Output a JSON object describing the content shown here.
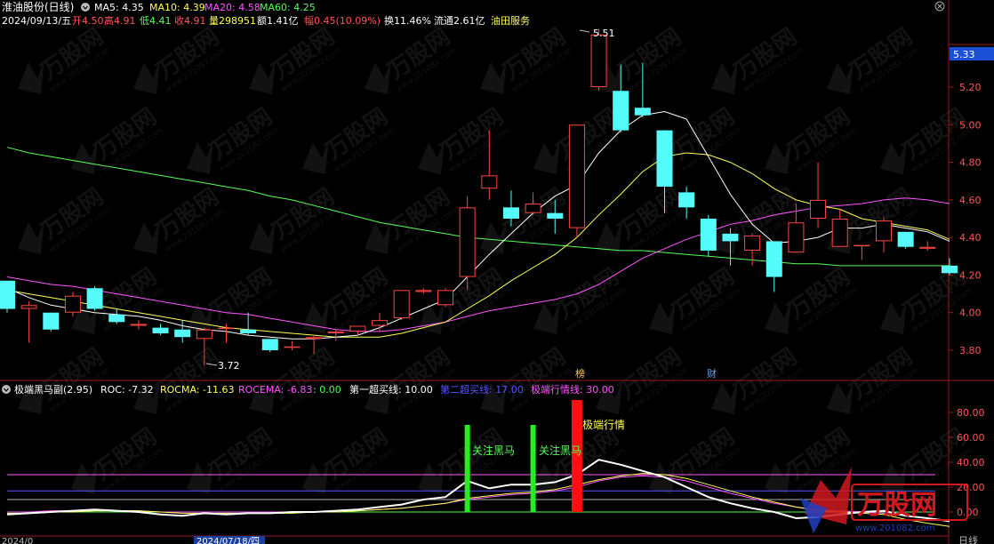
{
  "colors": {
    "up": "#ff4444",
    "down": "#54fcfc",
    "ma5": "#ffffff",
    "ma10": "#ffff55",
    "ma20": "#ff55ff",
    "ma60": "#55ff55",
    "axis_red": "#9a1a1a",
    "text_yellow": "#ffff55",
    "text_red": "#ff5555",
    "text_green": "#55ff55",
    "text_magenta": "#ff55ff",
    "text_blue": "#5555ff",
    "watermark_red": "#d0181f",
    "watermark_blue": "#1e3fbf"
  },
  "header": {
    "title": "淮油股份(日线)",
    "ma5": "MA5: 4.35",
    "ma10": "MA10: 4.39",
    "ma20": "MA20: 4.58",
    "ma60": "MA60: 4.25",
    "line2": {
      "date": "2024/09/13/五",
      "open": "开4.50",
      "high": "高4.91",
      "low": "低4.41",
      "close": "收4.91",
      "volume": "量298951",
      "amount": "额1.41亿",
      "change": "幅0.45(10.09%)",
      "turnover": "换11.46%",
      "float": "流通2.61亿",
      "sector": "油田服务"
    }
  },
  "price_axis": {
    "labels": [
      "5.20",
      "5.00",
      "4.80",
      "4.60",
      "4.40",
      "4.20",
      "4.00",
      "3.80"
    ],
    "current_label": "5.33"
  },
  "annotations": {
    "high_label": "5.51",
    "low_label": "3.72",
    "bang_tag": "榜",
    "cai_tag": "财"
  },
  "indicator": {
    "name": "极端黑马副(2.95)",
    "roc": "ROC: -7.32",
    "rocma": "ROCMA: -11.63",
    "rocema": "ROCEMA: -6.83",
    "zero": ": 0.00",
    "buy1": "第一超买线: 10.00",
    "buy2": "第二超买线: 17.00",
    "extreme": "极端行情线: 30.00",
    "axis_labels": [
      "80.00",
      "60.00",
      "40.00",
      "20.00",
      "0.00"
    ],
    "signal1": "关注黑马",
    "signal2": "关注黑马",
    "signal3": "极端行情"
  },
  "bottom_axis": {
    "date_label": "2024/07/18/四",
    "left_label": "2024/0",
    "right_label": "日线"
  },
  "watermark": {
    "brand": "万股网",
    "site": "www.201082.com"
  },
  "chart_data": {
    "type": "candlestick",
    "y_range": [
      3.7,
      5.55
    ],
    "candles": [
      {
        "o": 4.17,
        "h": 4.17,
        "l": 4.0,
        "c": 4.02
      },
      {
        "o": 4.02,
        "h": 4.06,
        "l": 3.84,
        "c": 4.04
      },
      {
        "o": 4.0,
        "h": 4.0,
        "l": 3.9,
        "c": 3.91
      },
      {
        "o": 4.0,
        "h": 4.11,
        "l": 3.98,
        "c": 4.09
      },
      {
        "o": 4.13,
        "h": 4.14,
        "l": 4.01,
        "c": 4.02
      },
      {
        "o": 3.99,
        "h": 4.02,
        "l": 3.94,
        "c": 3.95
      },
      {
        "o": 3.93,
        "h": 3.96,
        "l": 3.91,
        "c": 3.94
      },
      {
        "o": 3.92,
        "h": 3.94,
        "l": 3.88,
        "c": 3.89
      },
      {
        "o": 3.91,
        "h": 3.96,
        "l": 3.84,
        "c": 3.87
      },
      {
        "o": 3.86,
        "h": 3.92,
        "l": 3.72,
        "c": 3.91
      },
      {
        "o": 3.92,
        "h": 3.94,
        "l": 3.84,
        "c": 3.92
      },
      {
        "o": 3.91,
        "h": 4.0,
        "l": 3.88,
        "c": 3.89
      },
      {
        "o": 3.86,
        "h": 3.86,
        "l": 3.79,
        "c": 3.8
      },
      {
        "o": 3.82,
        "h": 3.85,
        "l": 3.8,
        "c": 3.82
      },
      {
        "o": 3.86,
        "h": 3.88,
        "l": 3.78,
        "c": 3.87
      },
      {
        "o": 3.89,
        "h": 3.91,
        "l": 3.85,
        "c": 3.9
      },
      {
        "o": 3.9,
        "h": 3.92,
        "l": 3.88,
        "c": 3.93
      },
      {
        "o": 3.93,
        "h": 4.0,
        "l": 3.9,
        "c": 3.96
      },
      {
        "o": 3.97,
        "h": 4.12,
        "l": 3.96,
        "c": 4.12
      },
      {
        "o": 4.11,
        "h": 4.13,
        "l": 4.1,
        "c": 4.12
      },
      {
        "o": 4.04,
        "h": 4.13,
        "l": 4.03,
        "c": 4.12
      },
      {
        "o": 4.19,
        "h": 4.62,
        "l": 4.12,
        "c": 4.56
      },
      {
        "o": 4.66,
        "h": 4.97,
        "l": 4.6,
        "c": 4.73
      },
      {
        "o": 4.56,
        "h": 4.65,
        "l": 4.46,
        "c": 4.5
      },
      {
        "o": 4.53,
        "h": 4.64,
        "l": 4.52,
        "c": 4.58
      },
      {
        "o": 4.53,
        "h": 4.6,
        "l": 4.42,
        "c": 4.5
      },
      {
        "o": 4.45,
        "h": 5.0,
        "l": 4.4,
        "c": 5.0
      },
      {
        "o": 5.2,
        "h": 5.51,
        "l": 5.18,
        "c": 5.48
      },
      {
        "o": 5.18,
        "h": 5.32,
        "l": 4.96,
        "c": 4.97
      },
      {
        "o": 5.09,
        "h": 5.33,
        "l": 5.04,
        "c": 5.05
      },
      {
        "o": 4.97,
        "h": 4.97,
        "l": 4.53,
        "c": 4.67
      },
      {
        "o": 4.64,
        "h": 4.67,
        "l": 4.5,
        "c": 4.56
      },
      {
        "o": 4.5,
        "h": 4.52,
        "l": 4.3,
        "c": 4.33
      },
      {
        "o": 4.42,
        "h": 4.45,
        "l": 4.25,
        "c": 4.38
      },
      {
        "o": 4.33,
        "h": 4.42,
        "l": 4.25,
        "c": 4.41
      },
      {
        "o": 4.38,
        "h": 4.38,
        "l": 4.11,
        "c": 4.19
      },
      {
        "o": 4.32,
        "h": 4.58,
        "l": 4.32,
        "c": 4.48
      },
      {
        "o": 4.5,
        "h": 4.8,
        "l": 4.45,
        "c": 4.6
      },
      {
        "o": 4.35,
        "h": 4.55,
        "l": 4.35,
        "c": 4.5
      },
      {
        "o": 4.36,
        "h": 4.36,
        "l": 4.28,
        "c": 4.36
      },
      {
        "o": 4.38,
        "h": 4.51,
        "l": 4.32,
        "c": 4.49
      },
      {
        "o": 4.43,
        "h": 4.43,
        "l": 4.34,
        "c": 4.35
      },
      {
        "o": 4.34,
        "h": 4.38,
        "l": 4.33,
        "c": 4.35
      },
      {
        "o": 4.25,
        "h": 4.29,
        "l": 4.2,
        "c": 4.21
      }
    ],
    "ma5": [
      4.13,
      4.08,
      4.04,
      4.02,
      4.0,
      3.99,
      3.98,
      3.96,
      3.93,
      3.91,
      3.9,
      3.88,
      3.87,
      3.86,
      3.86,
      3.87,
      3.88,
      3.92,
      3.97,
      4.02,
      4.07,
      4.19,
      4.31,
      4.42,
      4.53,
      4.62,
      4.68,
      4.85,
      4.97,
      5.05,
      5.07,
      5.03,
      4.83,
      4.63,
      4.47,
      4.37,
      4.38,
      4.4,
      4.45,
      4.45,
      4.47,
      4.45,
      4.43,
      4.38
    ],
    "ma10": [
      4.12,
      4.1,
      4.08,
      4.06,
      4.04,
      4.02,
      4.0,
      3.98,
      3.96,
      3.94,
      3.92,
      3.91,
      3.9,
      3.89,
      3.88,
      3.87,
      3.87,
      3.87,
      3.89,
      3.92,
      3.95,
      4.02,
      4.09,
      4.17,
      4.24,
      4.31,
      4.4,
      4.52,
      4.63,
      4.75,
      4.83,
      4.85,
      4.84,
      4.8,
      4.74,
      4.66,
      4.6,
      4.57,
      4.55,
      4.5,
      4.48,
      4.46,
      4.44,
      4.39
    ],
    "ma20": [
      4.19,
      4.17,
      4.15,
      4.14,
      4.12,
      4.1,
      4.08,
      4.06,
      4.04,
      4.02,
      4.0,
      3.99,
      3.97,
      3.95,
      3.93,
      3.91,
      3.9,
      3.9,
      3.91,
      3.93,
      3.95,
      3.98,
      4.01,
      4.03,
      4.05,
      4.07,
      4.1,
      4.15,
      4.22,
      4.29,
      4.34,
      4.39,
      4.43,
      4.47,
      4.49,
      4.52,
      4.54,
      4.56,
      4.57,
      4.58,
      4.6,
      4.61,
      4.6,
      4.58
    ],
    "ma60": [
      4.88,
      4.85,
      4.83,
      4.81,
      4.79,
      4.77,
      4.75,
      4.73,
      4.71,
      4.69,
      4.67,
      4.65,
      4.62,
      4.6,
      4.57,
      4.54,
      4.51,
      4.48,
      4.46,
      4.44,
      4.42,
      4.4,
      4.39,
      4.38,
      4.37,
      4.36,
      4.35,
      4.34,
      4.33,
      4.33,
      4.32,
      4.31,
      4.3,
      4.29,
      4.28,
      4.27,
      4.26,
      4.26,
      4.25,
      4.25,
      4.25,
      4.25,
      4.25,
      4.25
    ],
    "indicator_range": [
      -5,
      92
    ],
    "roc": [
      -2,
      -1,
      0,
      1,
      2,
      1,
      0,
      -2,
      -3,
      -1,
      -2,
      -1,
      -1,
      0,
      0,
      1,
      2,
      4,
      6,
      10,
      12,
      25,
      19,
      22,
      22,
      24,
      30,
      42,
      38,
      33,
      28,
      20,
      12,
      7,
      3,
      0,
      -5,
      -4,
      -2,
      0,
      1,
      -3,
      -5,
      -7.3
    ],
    "rocma": [
      -1,
      -1,
      0,
      0,
      1,
      1,
      1,
      0,
      -1,
      -1,
      -1,
      -1,
      -1,
      -1,
      0,
      0,
      1,
      2,
      3,
      5,
      7,
      11,
      13,
      15,
      16,
      18,
      22,
      26,
      29,
      31,
      30,
      27,
      22,
      17,
      12,
      8,
      4,
      1,
      0,
      -1,
      -2,
      -6,
      -9,
      -11.6
    ],
    "rocema": [
      0,
      0,
      1,
      1,
      1,
      1,
      1,
      0,
      0,
      0,
      0,
      0,
      0,
      0,
      0,
      1,
      1,
      2,
      3,
      5,
      7,
      10,
      12,
      14,
      15,
      17,
      20,
      25,
      28,
      29,
      28,
      25,
      20,
      15,
      11,
      7,
      4,
      2,
      1,
      0,
      -1,
      -3,
      -5,
      -6.8
    ],
    "buy_line1": 10,
    "buy_line2": 17,
    "extreme_line": 30,
    "signals": [
      {
        "index": 21,
        "type": "green",
        "top": 70
      },
      {
        "index": 24,
        "type": "green",
        "top": 70
      },
      {
        "index": 26,
        "type": "red",
        "top": 90
      }
    ]
  }
}
